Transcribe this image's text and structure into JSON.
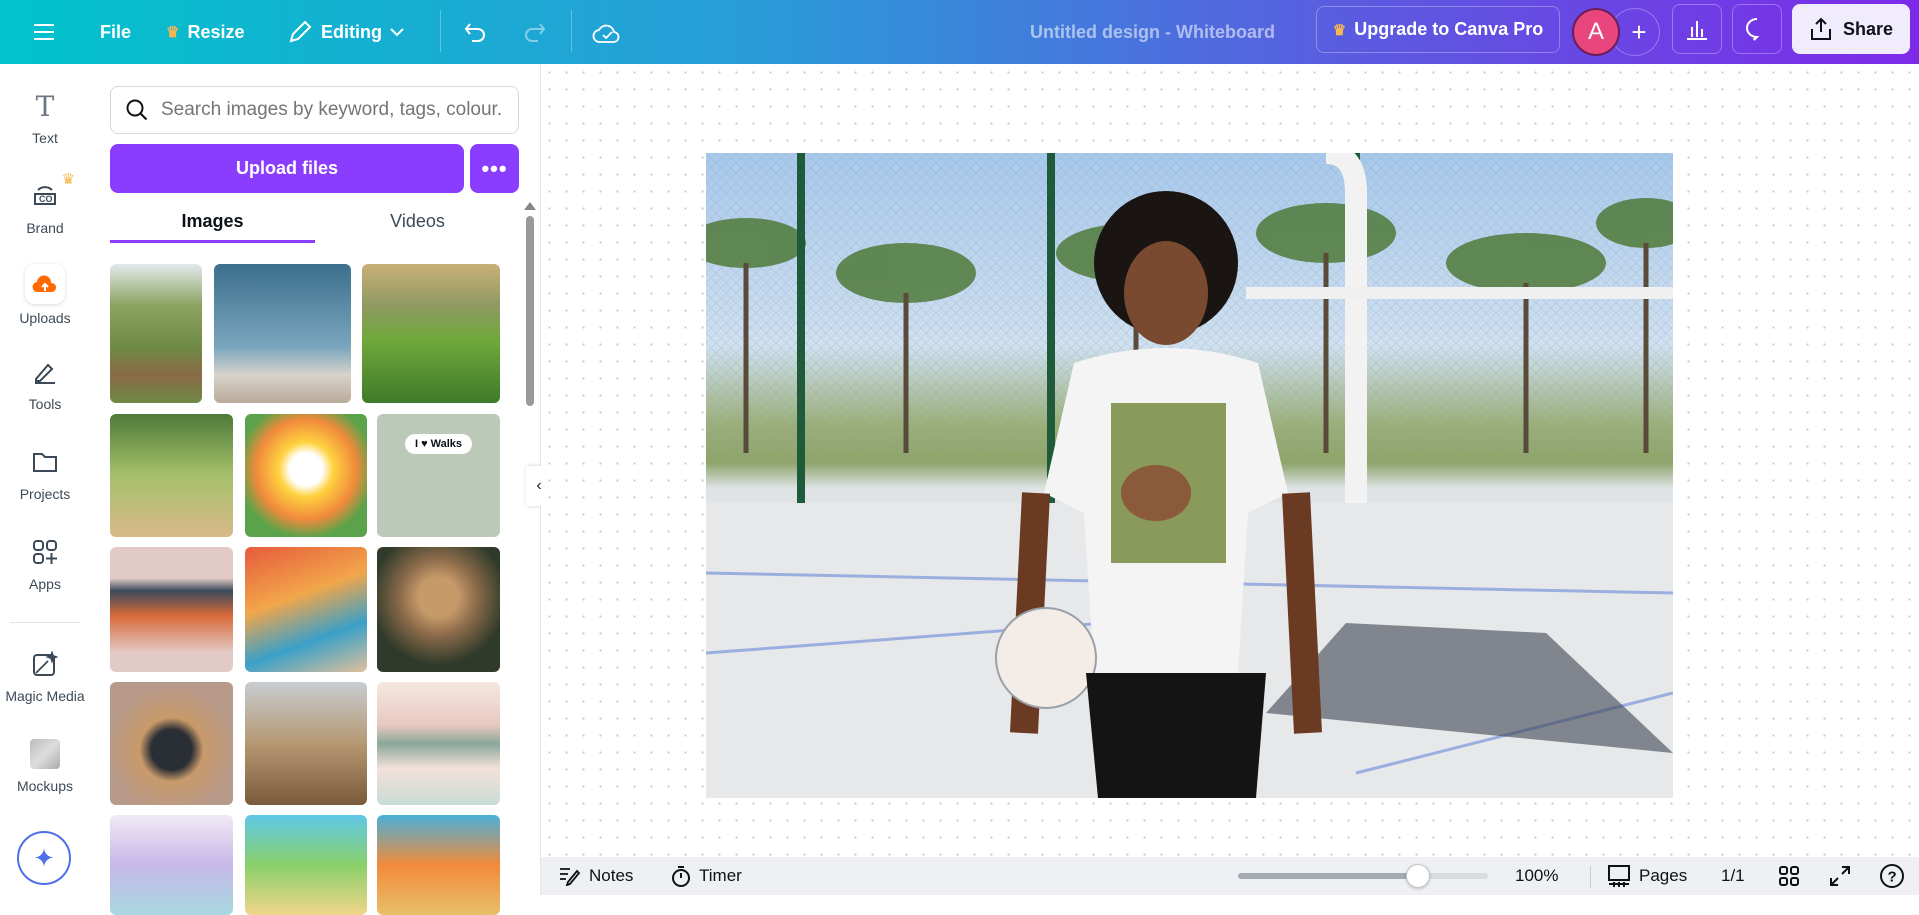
{
  "header": {
    "file": "File",
    "resize": "Resize",
    "editing": "Editing",
    "title": "Untitled design - Whiteboard",
    "upgrade": "Upgrade to Canva Pro",
    "avatar": "A",
    "share": "Share"
  },
  "rail": [
    {
      "label": "Text"
    },
    {
      "label": "Brand"
    },
    {
      "label": "Uploads"
    },
    {
      "label": "Tools"
    },
    {
      "label": "Projects"
    },
    {
      "label": "Apps"
    },
    {
      "label": "Magic Media"
    },
    {
      "label": "Mockups"
    }
  ],
  "panel": {
    "search_placeholder": "Search images by keyword, tags, colour...",
    "upload": "Upload files",
    "more": "•••",
    "tabs": [
      "Images",
      "Videos"
    ],
    "thumb_text": "I ♥ Walks"
  },
  "bottom": {
    "notes": "Notes",
    "timer": "Timer",
    "zoom": "100%",
    "zoom_slider_fraction": 0.72,
    "pages": "Pages",
    "page_count": "1/1"
  },
  "colors": {
    "accent": "#8b3dff",
    "avatar": "#e8467c",
    "uploads": "#ff6a00"
  }
}
